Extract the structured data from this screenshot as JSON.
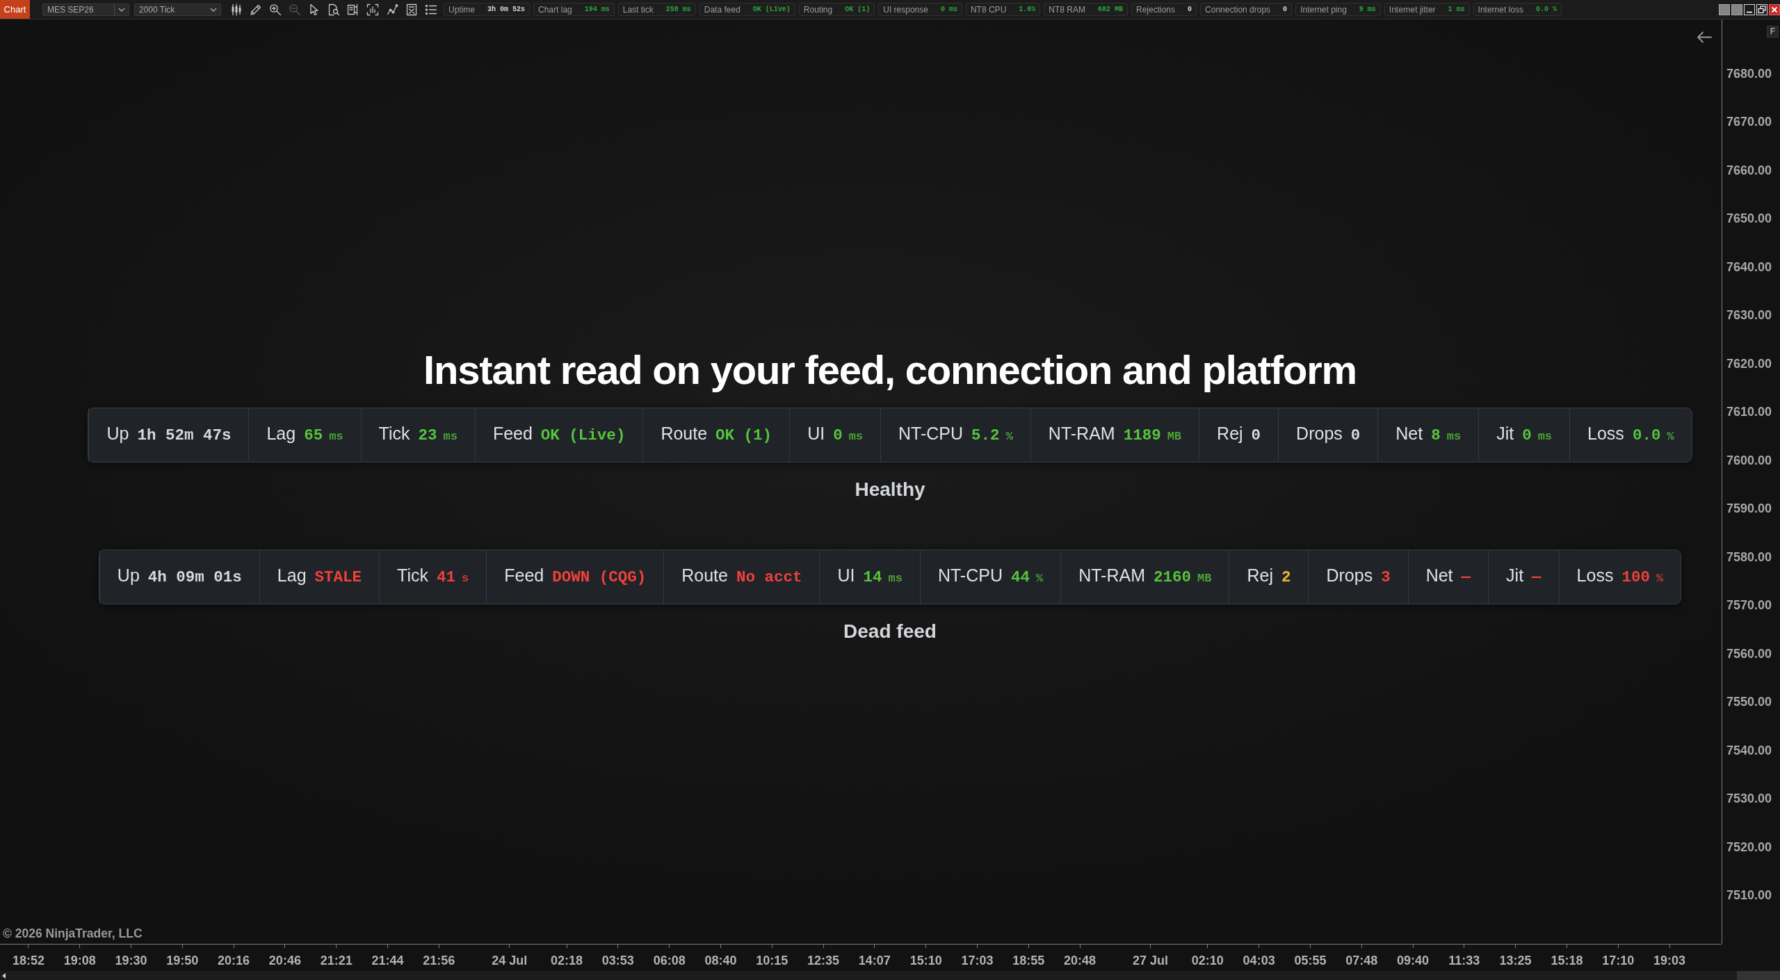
{
  "toolbar": {
    "tab": "Chart",
    "instrument": "MES SEP26",
    "interval": "2000 Tick",
    "tools": [
      {
        "kind": "bars",
        "disabled": false
      },
      {
        "kind": "pencil",
        "disabled": false
      },
      {
        "kind": "zoomin",
        "disabled": false
      },
      {
        "kind": "zoomout",
        "disabled": true
      },
      {
        "kind": "pointer",
        "disabled": false
      },
      {
        "kind": "inspect",
        "disabled": false
      },
      {
        "kind": "panel",
        "disabled": false
      },
      {
        "kind": "framechart",
        "disabled": false
      },
      {
        "kind": "polyline",
        "disabled": false
      },
      {
        "kind": "report",
        "disabled": false
      },
      {
        "kind": "list",
        "disabled": false
      }
    ],
    "metrics": [
      {
        "label": "Uptime",
        "value": "3h 0m 52s",
        "color": "#d4d4d4"
      },
      {
        "label": "Chart lag",
        "value": "194 ms",
        "color": "#2aa63a"
      },
      {
        "label": "Last tick",
        "value": "258 ms",
        "color": "#2aa63a"
      },
      {
        "label": "Data feed",
        "value": "OK (Live)",
        "color": "#2aa63a"
      },
      {
        "label": "Routing",
        "value": "OK (1)",
        "color": "#2aa63a"
      },
      {
        "label": "UI response",
        "value": "0 ms",
        "color": "#2aa63a"
      },
      {
        "label": "NT8 CPU",
        "value": "1.6%",
        "color": "#2aa63a"
      },
      {
        "label": "NT8 RAM",
        "value": "682 MB",
        "color": "#2aa63a"
      },
      {
        "label": "Rejections",
        "value": "0",
        "color": "#d4d4d4"
      },
      {
        "label": "Connection drops",
        "value": "0",
        "color": "#d4d4d4"
      },
      {
        "label": "Internet ping",
        "value": "9 ms",
        "color": "#2aa63a"
      },
      {
        "label": "Internet jitter",
        "value": "1 ms",
        "color": "#2aa63a"
      },
      {
        "label": "Internet loss",
        "value": "0.0 %",
        "color": "#2aa63a"
      }
    ]
  },
  "price_axis": {
    "button": "F",
    "labels": [
      "7680.00",
      "7670.00",
      "7660.00",
      "7650.00",
      "7640.00",
      "7630.00",
      "7620.00",
      "7610.00",
      "7600.00",
      "7590.00",
      "7580.00",
      "7570.00",
      "7560.00",
      "7550.00",
      "7540.00",
      "7530.00",
      "7520.00",
      "7510.00"
    ]
  },
  "headline": "Instant read on your feed, connection and platform",
  "panels": [
    {
      "caption": "Healthy",
      "metrics": [
        {
          "label": "Up",
          "value": "1h 52m 47s",
          "color": "#d6d9dd"
        },
        {
          "label": "Lag",
          "value": "65",
          "unit": "ms",
          "color": "#55c43b"
        },
        {
          "label": "Tick",
          "value": "23",
          "unit": "ms",
          "color": "#55c43b"
        },
        {
          "label": "Feed",
          "value": "OK (Live)",
          "color": "#55c43b"
        },
        {
          "label": "Route",
          "value": "OK (1)",
          "color": "#55c43b"
        },
        {
          "label": "UI",
          "value": "0",
          "unit": "ms",
          "color": "#55c43b"
        },
        {
          "label": "NT-CPU",
          "value": "5.2",
          "unit": "%",
          "color": "#55c43b"
        },
        {
          "label": "NT-RAM",
          "value": "1189",
          "unit": "MB",
          "color": "#55c43b"
        },
        {
          "label": "Rej",
          "value": "0",
          "color": "#d6d9dd"
        },
        {
          "label": "Drops",
          "value": "0",
          "color": "#d6d9dd"
        },
        {
          "label": "Net",
          "value": "8",
          "unit": "ms",
          "color": "#55c43b"
        },
        {
          "label": "Jit",
          "value": "0",
          "unit": "ms",
          "color": "#55c43b"
        },
        {
          "label": "Loss",
          "value": "0.0",
          "unit": "%",
          "color": "#55c43b"
        }
      ]
    },
    {
      "caption": "Dead feed",
      "metrics": [
        {
          "label": "Up",
          "value": "4h 09m 01s",
          "color": "#d6d9dd"
        },
        {
          "label": "Lag",
          "value": "STALE",
          "color": "#f0413c"
        },
        {
          "label": "Tick",
          "value": "41",
          "unit": "s",
          "color": "#f0413c"
        },
        {
          "label": "Feed",
          "value": "DOWN (CQG)",
          "color": "#f0413c"
        },
        {
          "label": "Route",
          "value": "No acct",
          "color": "#f0413c"
        },
        {
          "label": "UI",
          "value": "14",
          "unit": "ms",
          "color": "#55c43b"
        },
        {
          "label": "NT-CPU",
          "value": "44",
          "unit": "%",
          "color": "#55c43b"
        },
        {
          "label": "NT-RAM",
          "value": "2160",
          "unit": "MB",
          "color": "#55c43b"
        },
        {
          "label": "Rej",
          "value": "2",
          "color": "#f2b52f"
        },
        {
          "label": "Drops",
          "value": "3",
          "color": "#f0413c"
        },
        {
          "label": "Net",
          "value": "—",
          "color": "#f0413c"
        },
        {
          "label": "Jit",
          "value": "—",
          "color": "#f0413c"
        },
        {
          "label": "Loss",
          "value": "100",
          "unit": "%",
          "color": "#f0413c"
        }
      ]
    }
  ],
  "copyright": "© 2026 NinjaTrader, LLC",
  "time_axis": {
    "labels": [
      {
        "text": "18:52",
        "kind": "time"
      },
      {
        "text": "19:08",
        "kind": "time"
      },
      {
        "text": "19:30",
        "kind": "time"
      },
      {
        "text": "19:50",
        "kind": "time"
      },
      {
        "text": "20:16",
        "kind": "time"
      },
      {
        "text": "20:46",
        "kind": "time"
      },
      {
        "text": "21:21",
        "kind": "time"
      },
      {
        "text": "21:44",
        "kind": "time"
      },
      {
        "text": "21:56",
        "kind": "time"
      },
      {
        "text": "24 Jul",
        "kind": "date"
      },
      {
        "text": "02:18",
        "kind": "time"
      },
      {
        "text": "03:53",
        "kind": "time"
      },
      {
        "text": "06:08",
        "kind": "time"
      },
      {
        "text": "08:40",
        "kind": "time"
      },
      {
        "text": "10:15",
        "kind": "time"
      },
      {
        "text": "12:35",
        "kind": "time"
      },
      {
        "text": "14:07",
        "kind": "time"
      },
      {
        "text": "15:10",
        "kind": "time"
      },
      {
        "text": "17:03",
        "kind": "time"
      },
      {
        "text": "18:55",
        "kind": "time"
      },
      {
        "text": "20:48",
        "kind": "time"
      },
      {
        "text": "27 Jul",
        "kind": "date"
      },
      {
        "text": "02:10",
        "kind": "time"
      },
      {
        "text": "04:03",
        "kind": "time"
      },
      {
        "text": "05:55",
        "kind": "time"
      },
      {
        "text": "07:48",
        "kind": "time"
      },
      {
        "text": "09:40",
        "kind": "time"
      },
      {
        "text": "11:33",
        "kind": "time"
      },
      {
        "text": "13:25",
        "kind": "time"
      },
      {
        "text": "15:18",
        "kind": "time"
      },
      {
        "text": "17:10",
        "kind": "time"
      },
      {
        "text": "19:03",
        "kind": "time"
      }
    ]
  }
}
